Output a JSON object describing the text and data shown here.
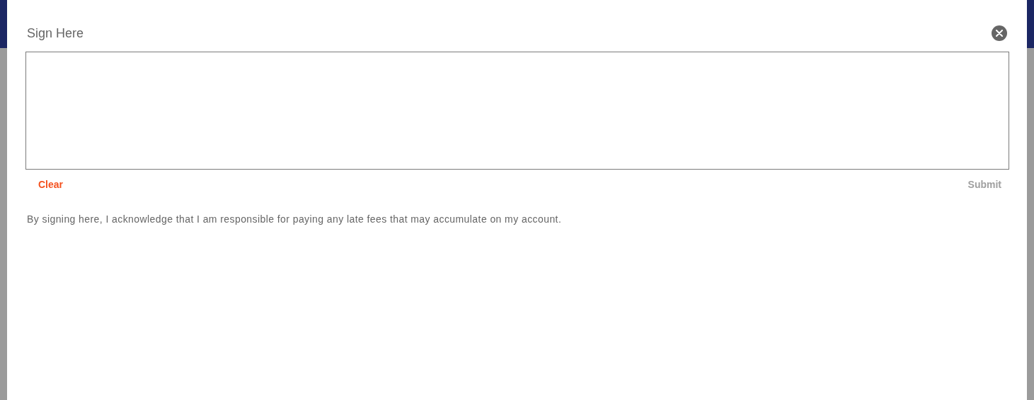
{
  "dialog": {
    "title": "Sign Here",
    "signature_pad": {
      "kind": "canvas"
    },
    "actions": [
      {
        "label": "Clear",
        "kind": "clear",
        "disabled": false
      },
      {
        "label": "Submit",
        "kind": "submit",
        "disabled": true
      }
    ],
    "acknowledgement": "By signing here, I acknowledge that I am responsible for paying any late fees that may accumulate on my account."
  }
}
